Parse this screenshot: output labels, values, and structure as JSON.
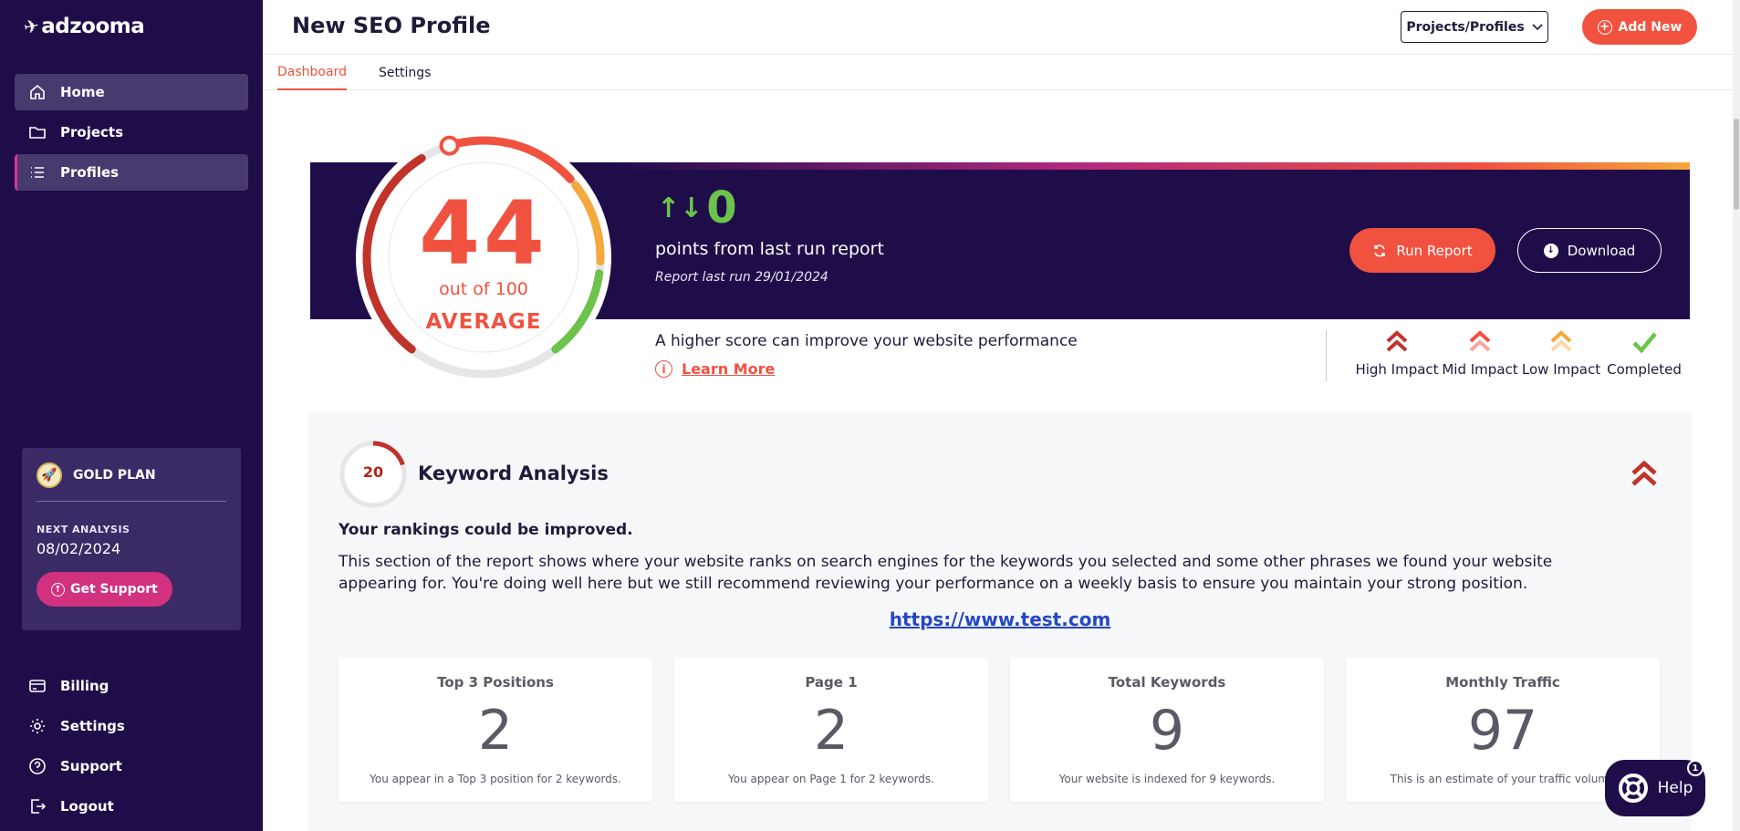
{
  "brand": {
    "name": "adzooma"
  },
  "sidebar": {
    "items": [
      {
        "label": "Home",
        "icon": "home-icon"
      },
      {
        "label": "Projects",
        "icon": "folder-icon"
      },
      {
        "label": "Profiles",
        "icon": "list-icon"
      }
    ],
    "plan": {
      "name": "GOLD PLAN",
      "next_label": "NEXT ANALYSIS",
      "next_date": "08/02/2024",
      "support_label": "Get Support"
    },
    "bottom_items": [
      {
        "label": "Billing",
        "icon": "card-icon"
      },
      {
        "label": "Settings",
        "icon": "gear-icon"
      },
      {
        "label": "Support",
        "icon": "question-icon"
      },
      {
        "label": "Logout",
        "icon": "logout-icon"
      }
    ]
  },
  "header": {
    "title": "New SEO Profile",
    "projects_button": "Projects/Profiles",
    "add_button": "Add New"
  },
  "tabs": [
    {
      "label": "Dashboard",
      "active": true
    },
    {
      "label": "Settings",
      "active": false
    }
  ],
  "score": {
    "value": "44",
    "out_of": "out of 100",
    "grade": "AVERAGE",
    "fraction": 0.44,
    "delta": "0",
    "delta_text": "points from last run report",
    "last_run": "Report last run 29/01/2024",
    "run_button": "Run Report",
    "download_button": "Download",
    "hint": "A higher score can improve your website performance",
    "learn_more": "Learn More"
  },
  "legend": [
    {
      "label": "High Impact",
      "color": "#c0332b"
    },
    {
      "label": "Mid Impact",
      "color": "#f0523f"
    },
    {
      "label": "Low Impact",
      "color": "#f5a83c"
    },
    {
      "label": "Completed",
      "color": "#6cc24a"
    }
  ],
  "keyword": {
    "score": "20",
    "score_fraction": 0.2,
    "title": "Keyword Analysis",
    "subtitle": "Your rankings could be improved.",
    "description": "This section of the report shows where your website ranks on search engines for the keywords you selected and some other phrases we found your website appearing for. You're doing well here but we still recommend reviewing your performance on a weekly basis to ensure you maintain your strong position.",
    "url": "https://www.test.com",
    "stats": [
      {
        "title": "Top 3 Positions",
        "value": "2",
        "note": "You appear in a Top 3 position for 2 keywords."
      },
      {
        "title": "Page 1",
        "value": "2",
        "note": "You appear on Page 1 for 2 keywords."
      },
      {
        "title": "Total Keywords",
        "value": "9",
        "note": "Your website is indexed for 9 keywords."
      },
      {
        "title": "Monthly Traffic",
        "value": "97",
        "note": "This is an estimate of your traffic volume"
      }
    ]
  },
  "help": {
    "label": "Help",
    "badge": "1"
  },
  "colors": {
    "brand_dark": "#1f0d4a",
    "accent": "#f0523f",
    "pink": "#d1317f",
    "success": "#6cc24a",
    "link": "#2547c5"
  }
}
